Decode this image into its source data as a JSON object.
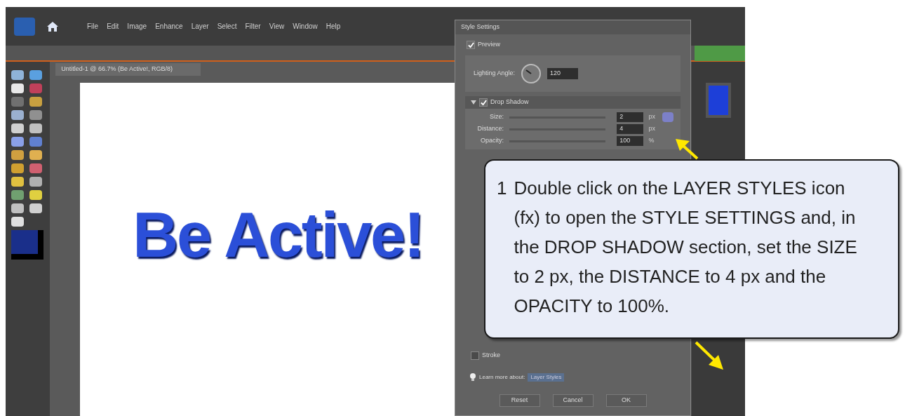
{
  "menu_bar": {
    "items": [
      "File",
      "Edit",
      "Image",
      "Enhance",
      "Layer",
      "Select",
      "Filter",
      "View",
      "Window",
      "Help"
    ]
  },
  "document": {
    "tab": "Untitled-1 @ 66.7% (Be Active!, RGB/8)",
    "canvas_text": "Be Active!"
  },
  "style_settings": {
    "title": "Style Settings",
    "preview": {
      "label": "Preview",
      "checked": true
    },
    "lighting_angle": {
      "label": "Lighting Angle:",
      "value": "120"
    },
    "drop_shadow": {
      "label": "Drop Shadow",
      "checked": true,
      "expanded": true,
      "rows": [
        {
          "label": "Size:",
          "value": "2",
          "unit": "px"
        },
        {
          "label": "Distance:",
          "value": "4",
          "unit": "px"
        },
        {
          "label": "Opacity:",
          "value": "100",
          "unit": "%"
        }
      ]
    },
    "stroke": {
      "label": "Stroke",
      "checked": false
    },
    "learn_more": {
      "text": "Learn more about:",
      "link": "Layer Styles"
    },
    "buttons": [
      "Reset",
      "Cancel",
      "OK"
    ]
  },
  "callout": {
    "number": "1",
    "text": "Double click on the LAYER STYLES icon (fx) to open the STYLE SETTINGS and, in the DROP SHADOW section, set the SIZE to 2 px, the DISTANCE to 4 px and the OPACITY to 100%."
  }
}
